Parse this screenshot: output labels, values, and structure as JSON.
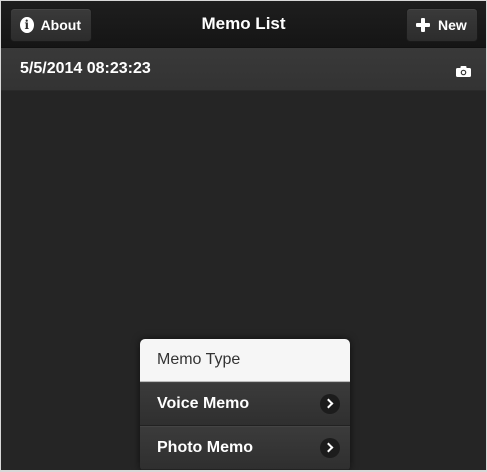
{
  "header": {
    "title": "Memo List",
    "about_label": "About",
    "new_label": "New"
  },
  "memos": [
    {
      "date": "5/5/2014 08:23:23",
      "icon": "camera-icon"
    }
  ],
  "popup": {
    "title": "Memo Type",
    "items": [
      {
        "label": "Voice Memo",
        "icon": "chevron-right-icon"
      },
      {
        "label": "Photo Memo",
        "icon": "chevron-right-icon"
      }
    ]
  },
  "colors": {
    "background": "#252525",
    "header": "#1a1a1a",
    "row": "#363636",
    "popup_header": "#f6f6f6"
  }
}
